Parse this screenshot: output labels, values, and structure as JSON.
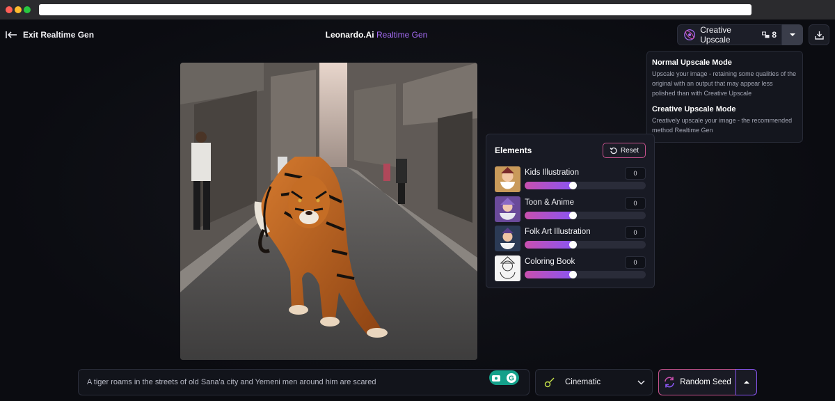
{
  "header": {
    "exit_label": "Exit Realtime Gen",
    "brand_name": "Leonardo.Ai",
    "brand_accent": "Realtime Gen",
    "upscale_label": "Creative Upscale",
    "upscale_count": "8"
  },
  "upscale_menu": {
    "items": [
      {
        "title": "Normal Upscale Mode",
        "description": "Upscale your image - retaining some qualities of the original with an output that may appear less polished than with Creative Upscale"
      },
      {
        "title": "Creative Upscale Mode",
        "description": "Creatively upscale your image - the recommended method Realtime Gen"
      }
    ]
  },
  "elements": {
    "title": "Elements",
    "reset_label": "Reset",
    "items": [
      {
        "name": "Kids Illustration",
        "value": "0",
        "level": 0.4
      },
      {
        "name": "Toon & Anime",
        "value": "0",
        "level": 0.4
      },
      {
        "name": "Folk Art Illustration",
        "value": "0",
        "level": 0.4
      },
      {
        "name": "Coloring Book",
        "value": "0",
        "level": 0.4
      }
    ]
  },
  "prompt": {
    "text": "A tiger roams in the streets of old Sana'a city and Yemeni men around him are scared"
  },
  "style": {
    "selected": "Cinematic"
  },
  "seed": {
    "label": "Random Seed"
  },
  "icons": {
    "exit": "exit-arrow-icon",
    "upscale": "upscale-orbit-icon",
    "credits": "credits-icon",
    "caret": "chevron-down-icon",
    "download": "download-icon",
    "reset": "reset-icon",
    "grammarly": "grammarly-icon",
    "style": "guitar-icon",
    "seed": "refresh-icon",
    "seed_caret": "chevron-up-icon"
  },
  "colors": {
    "accent_purple": "#a66cf5",
    "gradient_pink": "#c94fae",
    "gradient_violet": "#8a55f2",
    "background": "#0b0c11"
  }
}
